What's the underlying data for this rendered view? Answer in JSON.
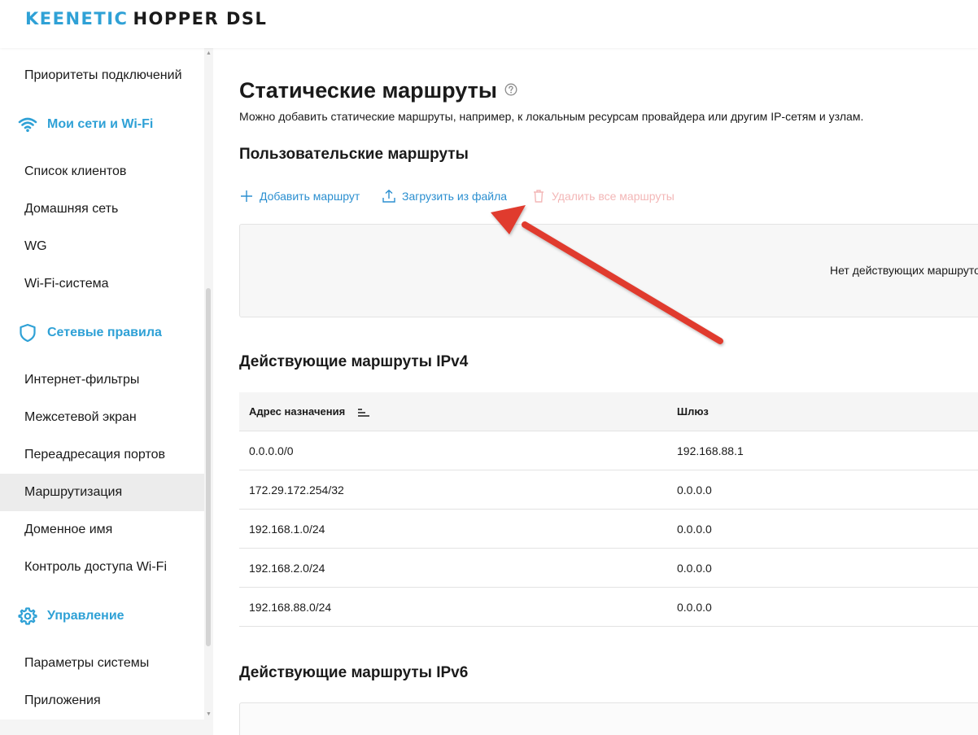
{
  "header": {
    "brand": "KEENETIC",
    "model": "HOPPER DSL"
  },
  "sidebar": {
    "items": [
      {
        "type": "item",
        "label": "Приоритеты подключений"
      },
      {
        "type": "group",
        "label": "Мои сети и Wi-Fi",
        "icon": "wifi-icon"
      },
      {
        "type": "item",
        "label": "Список клиентов"
      },
      {
        "type": "item",
        "label": "Домашняя сеть"
      },
      {
        "type": "item",
        "label": "WG"
      },
      {
        "type": "item",
        "label": "Wi-Fi-система"
      },
      {
        "type": "group",
        "label": "Сетевые правила",
        "icon": "shield-icon"
      },
      {
        "type": "item",
        "label": "Интернет-фильтры"
      },
      {
        "type": "item",
        "label": "Межсетевой экран"
      },
      {
        "type": "item",
        "label": "Переадресация портов"
      },
      {
        "type": "item",
        "label": "Маршрутизация",
        "active": true
      },
      {
        "type": "item",
        "label": "Доменное имя"
      },
      {
        "type": "item",
        "label": "Контроль доступа Wi-Fi"
      },
      {
        "type": "group",
        "label": "Управление",
        "icon": "gear-icon"
      },
      {
        "type": "item",
        "label": "Параметры системы"
      },
      {
        "type": "item",
        "label": "Приложения"
      }
    ]
  },
  "main": {
    "title": "Статические маршруты",
    "description": "Можно добавить статические маршруты, например, к локальным ресурсам провайдера или другим IP-сетям и узлам.",
    "user_routes": {
      "title": "Пользовательские маршруты",
      "actions": {
        "add": "Добавить маршрут",
        "upload": "Загрузить из файла",
        "delete_all": "Удалить все маршруты"
      },
      "empty_text": "Нет действующих маршрутов"
    },
    "ipv4": {
      "title": "Действующие маршруты IPv4",
      "columns": [
        "Адрес назначения",
        "Шлюз"
      ],
      "rows": [
        [
          "0.0.0.0/0",
          "192.168.88.1"
        ],
        [
          "172.29.172.254/32",
          "0.0.0.0"
        ],
        [
          "192.168.1.0/24",
          "0.0.0.0"
        ],
        [
          "192.168.2.0/24",
          "0.0.0.0"
        ],
        [
          "192.168.88.0/24",
          "0.0.0.0"
        ]
      ]
    },
    "ipv6": {
      "title": "Действующие маршруты IPv6"
    }
  },
  "colors": {
    "accent": "#2fa1d6",
    "link": "#2b8fd0",
    "disabled_danger": "#f3b7b7",
    "annotation_arrow": "#e03a2f",
    "active_item_bg": "#ececec"
  }
}
